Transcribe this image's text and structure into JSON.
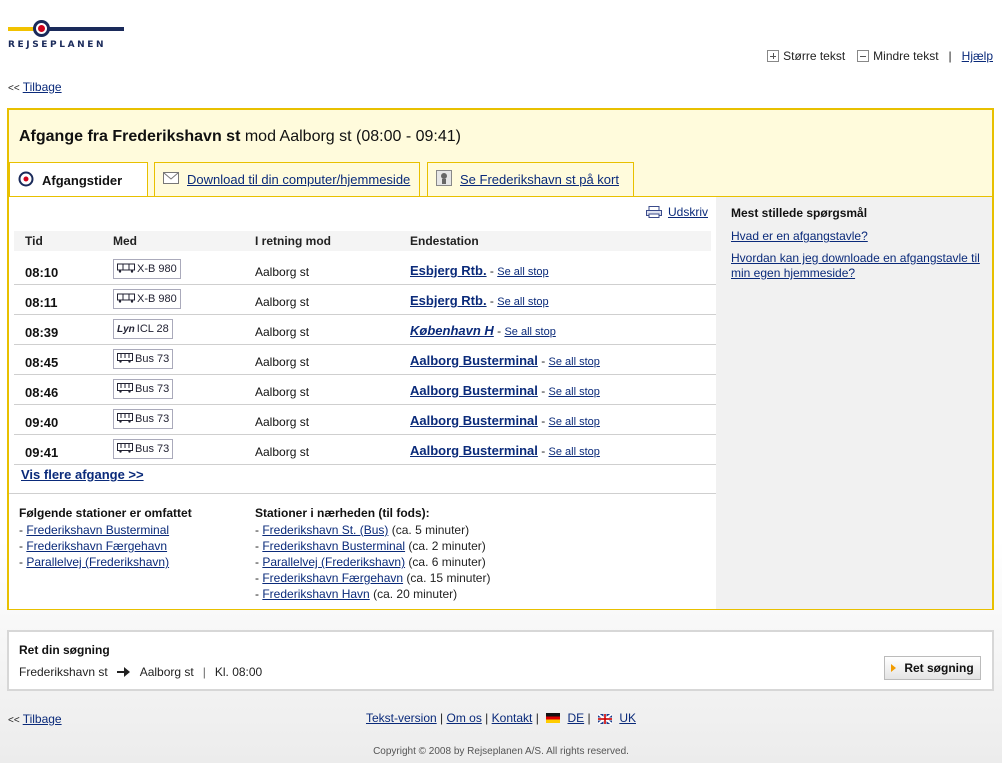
{
  "header": {
    "logo_text": "REJSEPLANEN",
    "larger_text": "Større tekst",
    "smaller_text": "Mindre tekst",
    "separator": "|",
    "help": "Hjælp"
  },
  "back": {
    "arrow": "<<",
    "label": "Tilbage"
  },
  "board": {
    "title_bold": "Afgange fra Frederikshavn st",
    "title_rest": " mod Aalborg st (08:00 - 09:41)",
    "tabs": [
      {
        "label": "Afgangstider",
        "icon": "departures-icon"
      },
      {
        "label": "Download til din computer/hjemmeside",
        "icon": "envelope-icon"
      },
      {
        "label": "Se Frederikshavn st på kort",
        "icon": "map-icon"
      }
    ],
    "print_label": "Udskriv",
    "columns": [
      "Tid",
      "Med",
      "I retning mod",
      "Endestation"
    ],
    "rows": [
      {
        "time": "08:10",
        "transport_icon": "train-icon",
        "transport": "X-B 980",
        "direction": "Aalborg st",
        "terminus": "Esbjerg Rtb.",
        "terminus_italic": false,
        "see_all": "Se all stop"
      },
      {
        "time": "08:11",
        "transport_icon": "train-icon",
        "transport": "X-B 980",
        "direction": "Aalborg st",
        "terminus": "Esbjerg Rtb.",
        "terminus_italic": false,
        "see_all": "Se all stop"
      },
      {
        "time": "08:39",
        "transport_icon": "lyn-icon",
        "transport_prefix": "Lyn",
        "transport": "ICL 28",
        "direction": "Aalborg st",
        "terminus": "København H",
        "terminus_italic": true,
        "see_all": "Se all stop"
      },
      {
        "time": "08:45",
        "transport_icon": "bus-icon",
        "transport": "Bus 73",
        "direction": "Aalborg st",
        "terminus": "Aalborg Busterminal",
        "terminus_italic": false,
        "see_all": "Se all stop"
      },
      {
        "time": "08:46",
        "transport_icon": "bus-icon",
        "transport": "Bus 73",
        "direction": "Aalborg st",
        "terminus": "Aalborg Busterminal",
        "terminus_italic": false,
        "see_all": "Se all stop"
      },
      {
        "time": "09:40",
        "transport_icon": "bus-icon",
        "transport": "Bus 73",
        "direction": "Aalborg st",
        "terminus": "Aalborg Busterminal",
        "terminus_italic": false,
        "see_all": "Se all stop"
      },
      {
        "time": "09:41",
        "transport_icon": "bus-icon",
        "transport": "Bus 73",
        "direction": "Aalborg st",
        "terminus": "Aalborg Busterminal",
        "terminus_italic": false,
        "see_all": "Se all stop"
      }
    ],
    "more_departures": "Vis flere afgange >>",
    "included_title": "Følgende stationer er omfattet",
    "included": [
      "Frederikshavn Busterminal",
      "Frederikshavn Færgehavn",
      "Parallelvej (Frederikshavn)"
    ],
    "nearby_title": "Stationer i nærheden (til fods):",
    "nearby": [
      {
        "name": "Frederikshavn St. (Bus)",
        "time": "(ca. 5 minuter)"
      },
      {
        "name": "Frederikshavn Busterminal",
        "time": "(ca. 2 minuter)"
      },
      {
        "name": "Parallelvej (Frederikshavn)",
        "time": "(ca. 6 minuter)"
      },
      {
        "name": "Frederikshavn Færgehavn",
        "time": "(ca. 15 minuter)"
      },
      {
        "name": "Frederikshavn Havn",
        "time": "(ca. 20 minuter)"
      }
    ],
    "faq_title": "Mest stillede spørgsmål",
    "faq": [
      "Hvad er en afgangstavle?",
      "Hvordan kan jeg downloade en afgangstavle til min egen hjemmeside?"
    ]
  },
  "refine": {
    "title": "Ret din søgning",
    "from": "Frederikshavn st",
    "to": "Aalborg st",
    "time": "Kl. 08:00",
    "button": "Ret søgning"
  },
  "footer": {
    "text_version": "Tekst-version",
    "about": "Om os",
    "contact": "Kontakt",
    "de": "DE",
    "uk": "UK",
    "sep": "|",
    "copyright": "Copyright © 2008 by Rejseplanen A/S. All rights reserved."
  },
  "colors": {
    "accent_border": "#e8c000",
    "link": "#0a2a7a",
    "panel_bg": "#fffbdc"
  }
}
